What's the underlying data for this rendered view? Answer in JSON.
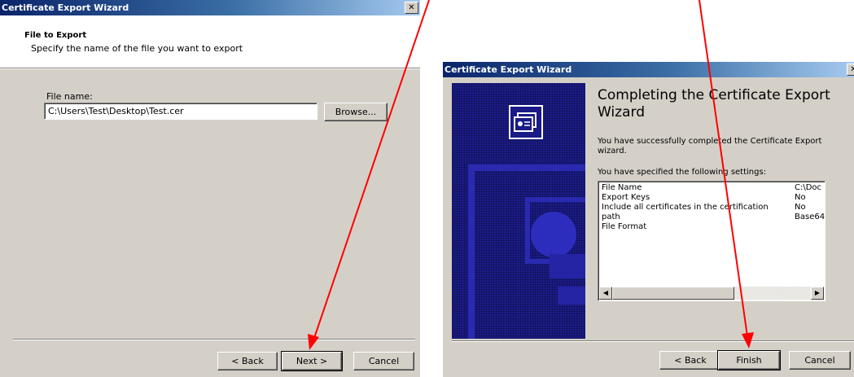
{
  "left": {
    "title": "Certificate Export Wizard",
    "close": "✕",
    "heading": "File to Export",
    "subheading": "Specify the name of the file you want to export",
    "file_label": "File name:",
    "file_value": "C:\\Users\\Test\\Desktop\\Test.cer",
    "browse": "Browse...",
    "back": "< Back",
    "next": "Next >",
    "cancel": "Cancel"
  },
  "right": {
    "title": "Certificate Export Wizard",
    "close": "✕",
    "heading": "Completing the Certificate Export Wizard",
    "success": "You have successfully completed the Certificate Export wizard.",
    "settings_label": "You have specified the following settings:",
    "settings": [
      {
        "name": "File Name",
        "value": "C:\\Doc"
      },
      {
        "name": "Export Keys",
        "value": "No"
      },
      {
        "name": "Include all certificates in the certification path",
        "value": "No"
      },
      {
        "name": "File Format",
        "value": "Base64"
      }
    ],
    "back": "< Back",
    "finish": "Finish",
    "cancel": "Cancel"
  },
  "colors": {
    "annotation_arrow": "#ff0000",
    "title_gradient_start": "#0a246a",
    "dialog_face": "#d4d0c8",
    "banner_blue": "#1c1c8c"
  }
}
